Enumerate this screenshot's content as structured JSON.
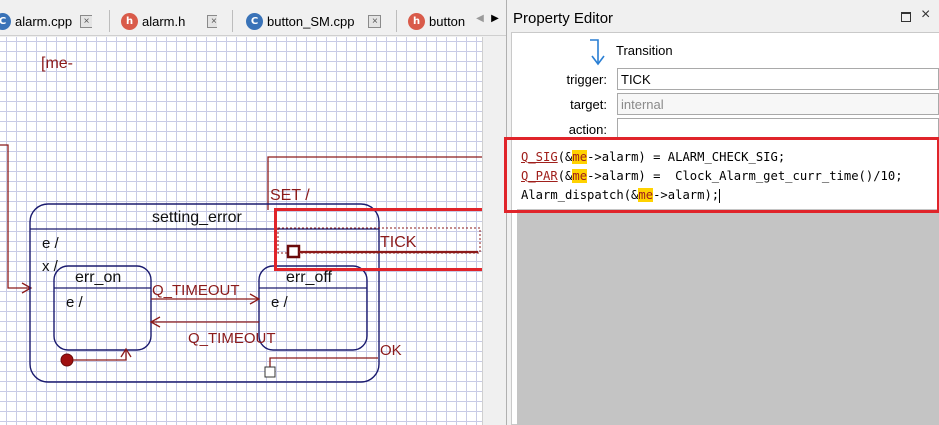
{
  "tabs": [
    {
      "label": "alarm.cpp",
      "icon": "cpp-file-icon"
    },
    {
      "label": "alarm.h",
      "icon": "header-file-icon"
    },
    {
      "label": "button_SM.cpp",
      "icon": "cpp-file-icon"
    },
    {
      "label": "button",
      "icon": "header-file-icon"
    }
  ],
  "tab_close_glyph": "×",
  "tab_scroll": {
    "left": "◀",
    "right": "▶"
  },
  "diagram": {
    "top_text": "[me-",
    "state_name": "setting_error",
    "state_entry": "e /",
    "state_exit": "x /",
    "substate1": {
      "name": "err_on",
      "entry": "e /"
    },
    "substate2": {
      "name": "err_off",
      "entry": "e /"
    },
    "transitions": {
      "set": "SET /",
      "tick": "TICK",
      "timeout_forward": "Q_TIMEOUT",
      "timeout_back": "Q_TIMEOUT",
      "ok": "OK"
    },
    "colors": {
      "state_border": "#1a1a6e",
      "transition": "#8b1a1a",
      "highlight": "#e0242a"
    }
  },
  "property_editor": {
    "title": "Property Editor",
    "element_kind": "Transition",
    "trigger_label": "trigger:",
    "trigger_value": "TICK",
    "target_label": "target:",
    "target_value": "internal",
    "action_label": "action:",
    "action_value": "",
    "code": {
      "line1": {
        "kw": "Q_SIG",
        "p1": "(&",
        "me": "me",
        "p2": "->alarm) = ALARM_CHECK_SIG;"
      },
      "line2": {
        "kw": "Q_PAR",
        "p1": "(&",
        "me": "me",
        "p2": "->alarm) =  Clock_Alarm_get_curr_time()/10;"
      },
      "line3": {
        "p1": "Alarm_dispatch(&",
        "me": "me",
        "p2": "->alarm);"
      }
    }
  }
}
